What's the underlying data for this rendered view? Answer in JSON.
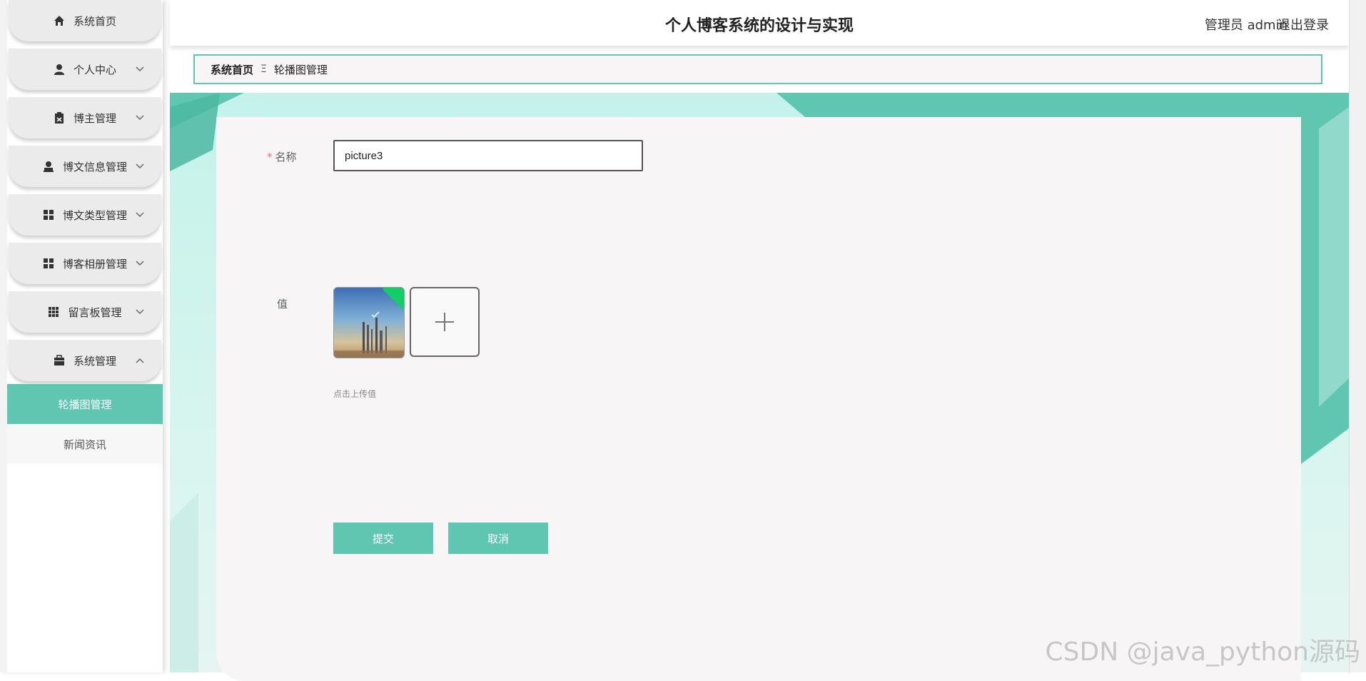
{
  "header": {
    "title": "个人博客系统的设计与实现",
    "admin_label": "管理员 admin",
    "logout_label": "退出登录"
  },
  "sidebar": {
    "items": [
      {
        "label": "系统首页",
        "icon": "home-icon"
      },
      {
        "label": "个人中心",
        "icon": "user-icon"
      },
      {
        "label": "博主管理",
        "icon": "clipboard-icon"
      },
      {
        "label": "博文信息管理",
        "icon": "stamp-icon"
      },
      {
        "label": "博文类型管理",
        "icon": "grid-icon"
      },
      {
        "label": "博客相册管理",
        "icon": "grid-icon"
      },
      {
        "label": "留言板管理",
        "icon": "apps-icon"
      },
      {
        "label": "系统管理",
        "icon": "briefcase-icon"
      }
    ],
    "subitems": [
      {
        "label": "轮播图管理",
        "active": true
      },
      {
        "label": "新闻资讯",
        "active": false
      }
    ]
  },
  "breadcrumb": {
    "home": "系统首页",
    "separator": "Ξ",
    "current": "轮播图管理"
  },
  "form": {
    "name_label": "名称",
    "required_mark": "*",
    "name_value": "picture3",
    "value_label": "值",
    "upload_hint": "点击上传值",
    "submit_label": "提交",
    "cancel_label": "取消"
  },
  "watermark": "CSDN @java_python源码",
  "colors": {
    "accent": "#5fc6b1",
    "required": "#f56c6c",
    "success_corner": "#13ce66"
  }
}
